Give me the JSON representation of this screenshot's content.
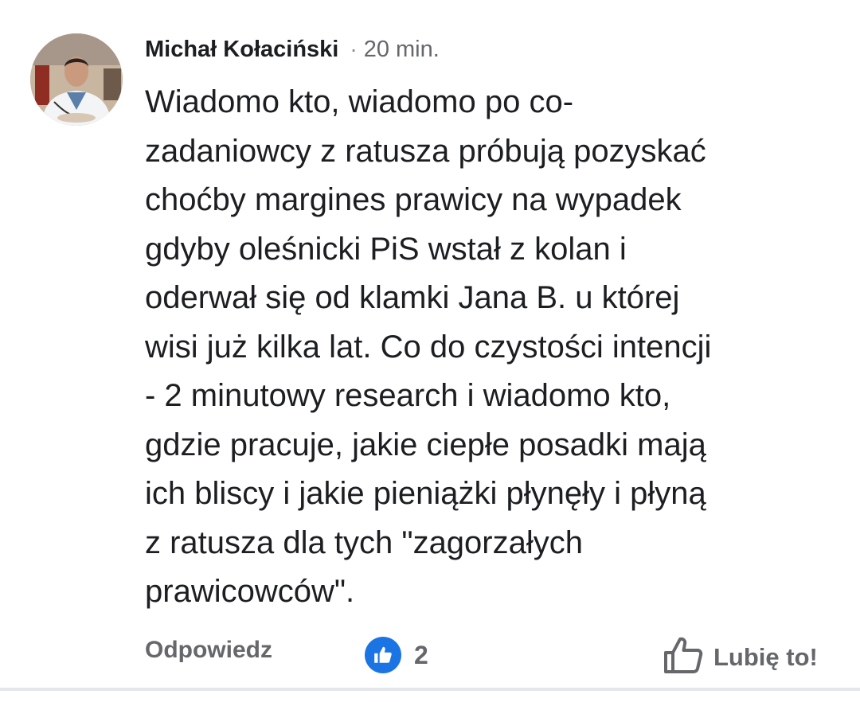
{
  "comment": {
    "author": "Michał Kołaciński",
    "separator": "·",
    "time": "20 min.",
    "avatar_icon": "user-avatar-photo",
    "lines": [
      "Wiadomo kto, wiadomo po co-",
      "zadaniowcy z ratusza próbują pozyskać",
      "choćby margines prawicy na wypadek",
      "gdyby oleśnicki PiS wstał z kolan i",
      "oderwał się od klamki Jana B. u której",
      "wisi już kilka lat. Co do czystości intencji",
      "- 2 minutowy research i wiadomo kto,",
      "gdzie pracuje, jakie ciepłe posadki mają",
      "ich bliscy i jakie pieniążki płynęły i płyną",
      "z ratusza dla tych \"zagorzałych",
      "prawicowców\"."
    ]
  },
  "actions": {
    "reply_label": "Odpowiedz",
    "reaction_icon": "like-reaction-icon",
    "reaction_count": "2",
    "like_icon": "thumbs-up-outline-icon",
    "like_label": "Lubię to!"
  },
  "colors": {
    "text_primary": "#1c1e21",
    "text_secondary": "#65676b",
    "like_blue": "#1b74e4",
    "divider": "#e4e6eb"
  }
}
